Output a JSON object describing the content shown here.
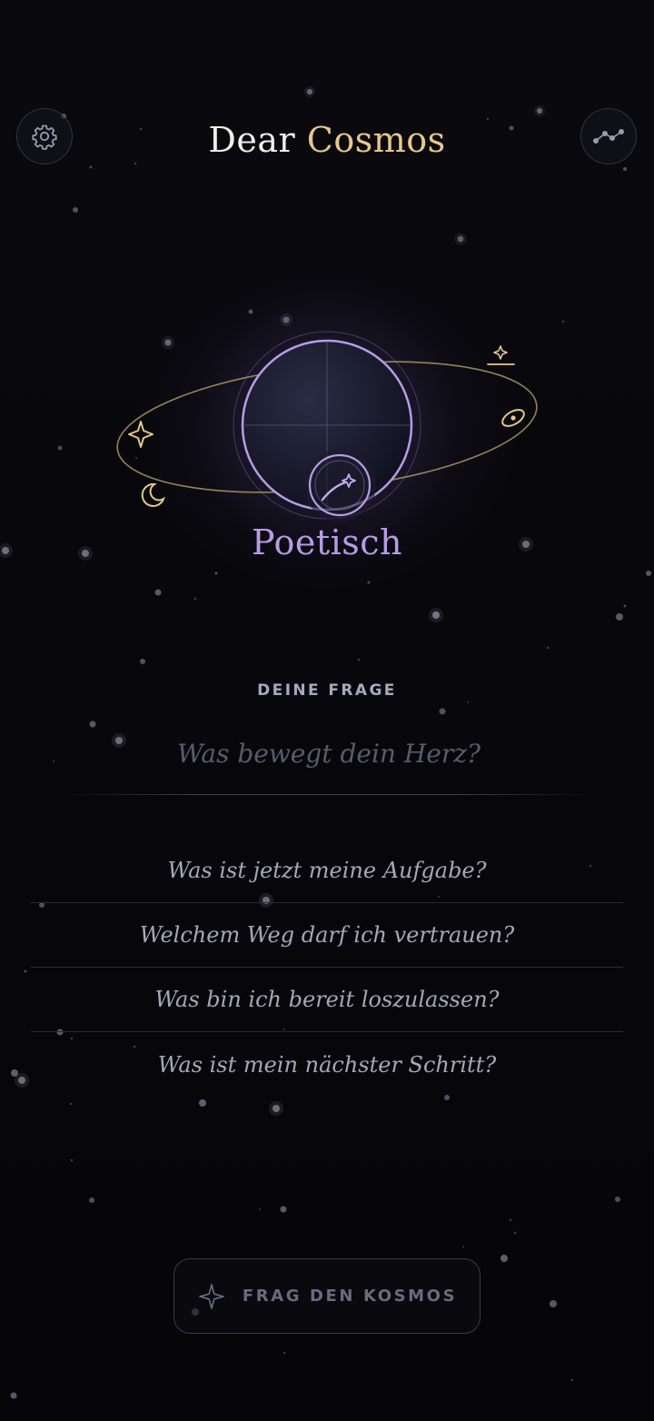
{
  "header": {
    "title_part1": "Dear",
    "title_part2": "Cosmos",
    "settings_icon": "gear-icon",
    "stats_icon": "line-chart-icon"
  },
  "mode": {
    "label": "Poetisch",
    "icon": "shooting-star-icon"
  },
  "question": {
    "heading": "DEINE FRAGE",
    "placeholder": "Was bewegt dein Herz?",
    "value": ""
  },
  "suggestions": [
    {
      "label": "Was ist jetzt meine Aufgabe?"
    },
    {
      "label": "Welchem Weg darf ich vertrauen?"
    },
    {
      "label": "Was bin ich bereit loszulassen?"
    },
    {
      "label": "Was ist mein nächster Schritt?"
    }
  ],
  "ask_button": {
    "label": "FRAG DEN KOSMOS",
    "icon": "sparkle-icon"
  },
  "colors": {
    "background": "#07070b",
    "accent_gold": "#e6c88a",
    "accent_purple": "#b79be6"
  }
}
